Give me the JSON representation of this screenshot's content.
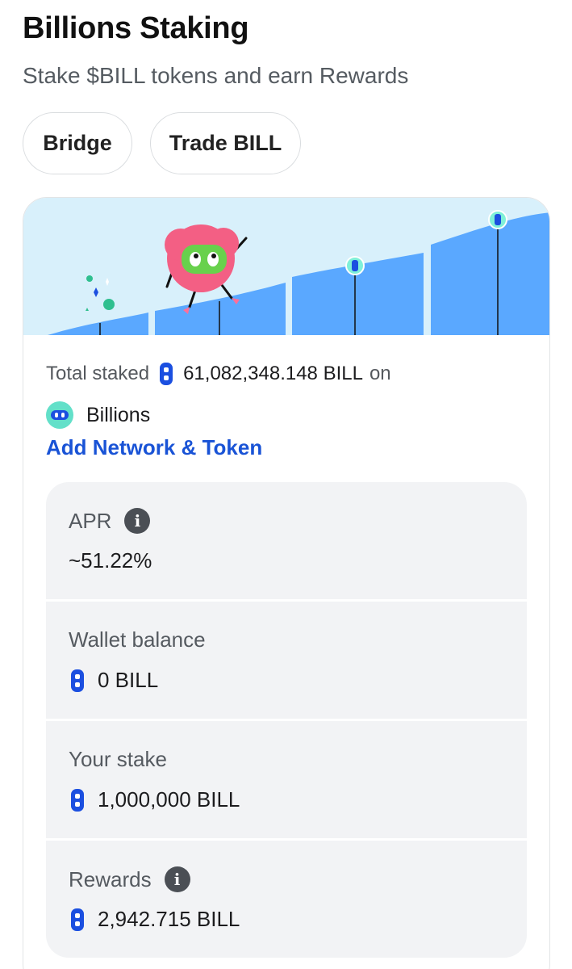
{
  "header": {
    "title": "Billions Staking",
    "subtitle": "Stake $BILL tokens and earn Rewards"
  },
  "actions": {
    "bridge_label": "Bridge",
    "trade_label": "Trade BILL"
  },
  "summary": {
    "total_staked_label": "Total staked",
    "total_staked_amount": "61,082,348.148 BILL",
    "on_label": "on",
    "network_name": "Billions",
    "add_network_label": "Add Network & Token"
  },
  "stats": {
    "apr": {
      "label": "APR",
      "value": "~51.22%"
    },
    "wallet_balance": {
      "label": "Wallet balance",
      "value": "0 BILL"
    },
    "your_stake": {
      "label": "Your stake",
      "value": "1,000,000 BILL"
    },
    "rewards": {
      "label": "Rewards",
      "value": "2,942.715 BILL"
    }
  },
  "colors": {
    "accent_link": "#1953d6",
    "token_blue": "#1b4fe0",
    "chart_blue": "#5aa8ff",
    "hero_bg": "#d8f0fb",
    "network_teal": "#63e0c9"
  },
  "icons": {
    "token": "bill-token-icon",
    "info": "info-icon",
    "network": "billions-network-logo"
  }
}
